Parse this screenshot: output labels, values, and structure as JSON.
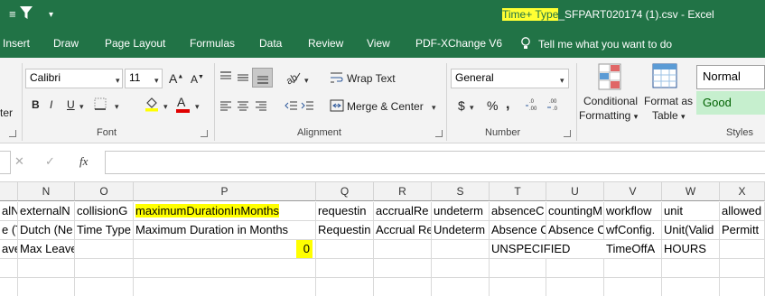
{
  "titlebar": {
    "title_highlight": "Time+ Type",
    "title_rest": "_SFPART020174 (1).csv  -  Excel",
    "qat_more": "≡",
    "qat_filter": "⏷",
    "qat_dropdown": "▾"
  },
  "tabs": [
    "Insert",
    "Draw",
    "Page Layout",
    "Formulas",
    "Data",
    "Review",
    "View",
    "PDF-XChange V6"
  ],
  "tellme": "Tell me what you want to do",
  "ribbon": {
    "clipboard_partial": "ter",
    "font_name": "Calibri",
    "font_size": "11",
    "font_group": "Font",
    "wrap_text": "Wrap Text",
    "merge_center": "Merge & Center",
    "alignment_group": "Alignment",
    "number_format": "General",
    "number_group": "Number",
    "cond_formatting_1": "Conditional",
    "cond_formatting_2": "Formatting",
    "format_table_1": "Format as",
    "format_table_2": "Table",
    "style_normal": "Normal",
    "style_good": "Good",
    "styles_group": "Styles",
    "bold": "B",
    "italic": "I",
    "underline": "U",
    "dollar": "$",
    "percent": "%",
    "comma": ",",
    "grow_font": "A",
    "shrink_font": "A",
    "font_color_letter": "A"
  },
  "formula_bar": {
    "cancel": "✕",
    "enter": "✓",
    "fx": "fx",
    "value": ""
  },
  "columns": [
    "",
    "N",
    "O",
    "P",
    "Q",
    "R",
    "S",
    "T",
    "U",
    "V",
    "W",
    "X"
  ],
  "rows": [
    [
      "alN",
      "externalN",
      "collisionG",
      "maximumDurationInMonths",
      "requestin",
      "accrualRe",
      "undeterm",
      "absenceC",
      "countingM",
      "workflow",
      "unit",
      "allowed"
    ],
    [
      "e (T",
      "Dutch (Ne",
      "Time Type",
      "Maximum Duration in Months",
      "Requestin",
      "Accrual Re",
      "Undeterm",
      "Absence C",
      "Absence C",
      "wfConfig.",
      "Unit(Valid",
      "Permitt"
    ],
    [
      "ave",
      "Max Leave",
      "",
      "0",
      "",
      "",
      "",
      "UNSPECIFIED",
      "",
      "TimeOffA",
      "HOURS",
      ""
    ],
    [
      "",
      "",
      "",
      "",
      "",
      "",
      "",
      "",
      "",
      "",
      "",
      ""
    ],
    [
      "",
      "",
      "",
      "",
      "",
      "",
      "",
      "",
      "",
      "",
      "",
      ""
    ]
  ],
  "colors": {
    "excel_green": "#217346",
    "highlight": "#ffff00",
    "good_fill": "#c6efce",
    "good_text": "#006100"
  }
}
